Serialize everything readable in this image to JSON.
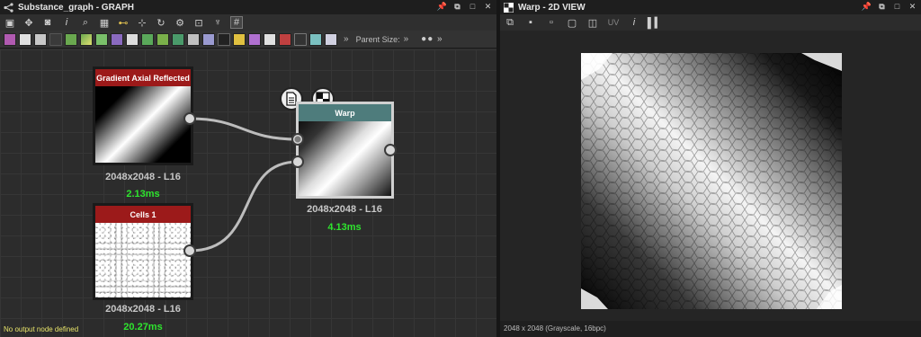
{
  "graph_window": {
    "title": "Substance_graph - GRAPH",
    "parent_size_label": "Parent Size:",
    "status_message": "No output node defined",
    "toolbar_icons": [
      "frame-icon",
      "move-icon",
      "camera-icon",
      "info-icon",
      "search-icon",
      "grid-icon",
      "node-layout-icon",
      "link-icon",
      "refresh-icon",
      "settings-icon",
      "export-icon",
      "clean-icon",
      "grid-snap-icon"
    ],
    "library_icons": [
      "image-icon",
      "text-icon",
      "color-icon",
      "shuffle-icon",
      "curve-icon",
      "gradient-icon",
      "grayscale-icon",
      "blend-icon",
      "tile-icon",
      "filter-icon",
      "fx-icon",
      "warp-icon",
      "transform-icon",
      "levels-icon",
      "bitmap-icon",
      "svg-icon",
      "text-node-icon",
      "uniform-icon",
      "input-icon",
      "output-icon",
      "switch-icon",
      "comment-icon"
    ]
  },
  "nodes": {
    "gradient": {
      "title": "Gradient Axial Reflected",
      "resolution": "2048x2048 - L16",
      "time": "2.13ms",
      "header_color": "#9c1a1a"
    },
    "cells": {
      "title": "Cells 1",
      "resolution": "2048x2048 - L16",
      "time": "20.27ms",
      "header_color": "#9c1a1a"
    },
    "warp": {
      "title": "Warp",
      "resolution": "2048x2048 - L16",
      "time": "4.13ms",
      "header_color": "#4e7c7c"
    }
  },
  "view_window": {
    "title": "Warp - 2D VIEW",
    "status": "2048 x 2048 (Grayscale, 16bpc)",
    "toolbar_icons": [
      "copy-icon",
      "save-icon",
      "save-as-icon",
      "display-icon",
      "channels-icon",
      "uv-icon",
      "info-icon",
      "histogram-icon"
    ]
  },
  "colors": {
    "accent_green": "#2ee52e",
    "status_yellow": "#e8e46a"
  }
}
